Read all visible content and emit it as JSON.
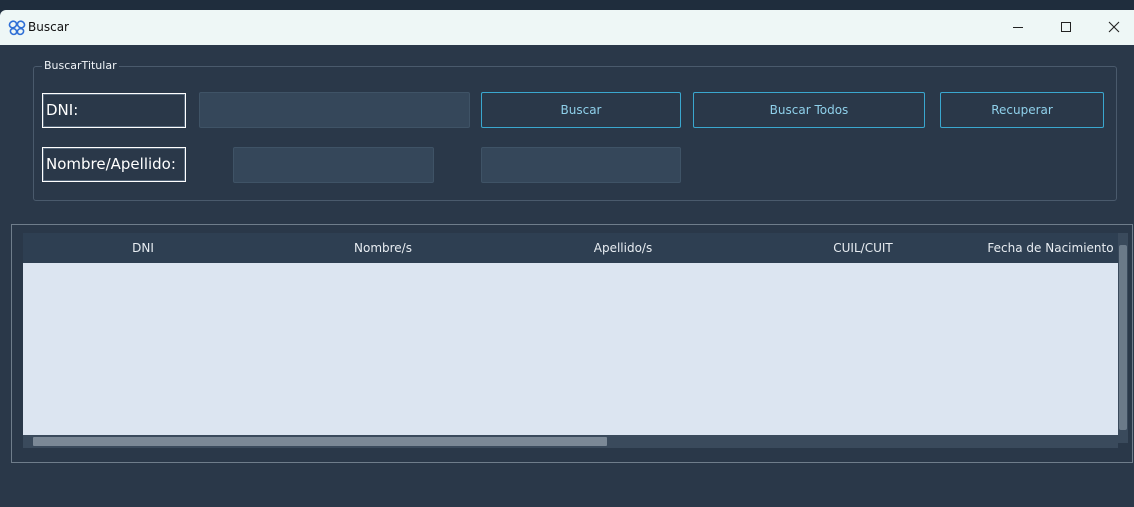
{
  "window": {
    "title": "Buscar",
    "icon": "butterfly-icon",
    "controls": {
      "minimize": "minimize-icon",
      "maximize": "maximize-icon",
      "close": "close-icon"
    }
  },
  "group": {
    "legend": "BuscarTitular",
    "dni_label": "DNI:",
    "nombre_label": "Nombre/Apellido:",
    "dni_input": {
      "value": "",
      "placeholder": ""
    },
    "nombre_input": {
      "value": "",
      "placeholder": ""
    },
    "apellido_input": {
      "value": "",
      "placeholder": ""
    },
    "buttons": {
      "buscar": "Buscar",
      "buscar_todos": "Buscar Todos",
      "recuperar": "Recuperar"
    }
  },
  "table": {
    "columns": [
      "DNI",
      "Nombre/s",
      "Apellido/s",
      "CUIL/CUIT",
      "Fecha de Nacimiento"
    ],
    "rows": []
  },
  "colors": {
    "window_bg": "#2a3849",
    "accent": "#3aa7cf",
    "table_body": "#dce5f1",
    "titlebar": "#eef7f6"
  }
}
